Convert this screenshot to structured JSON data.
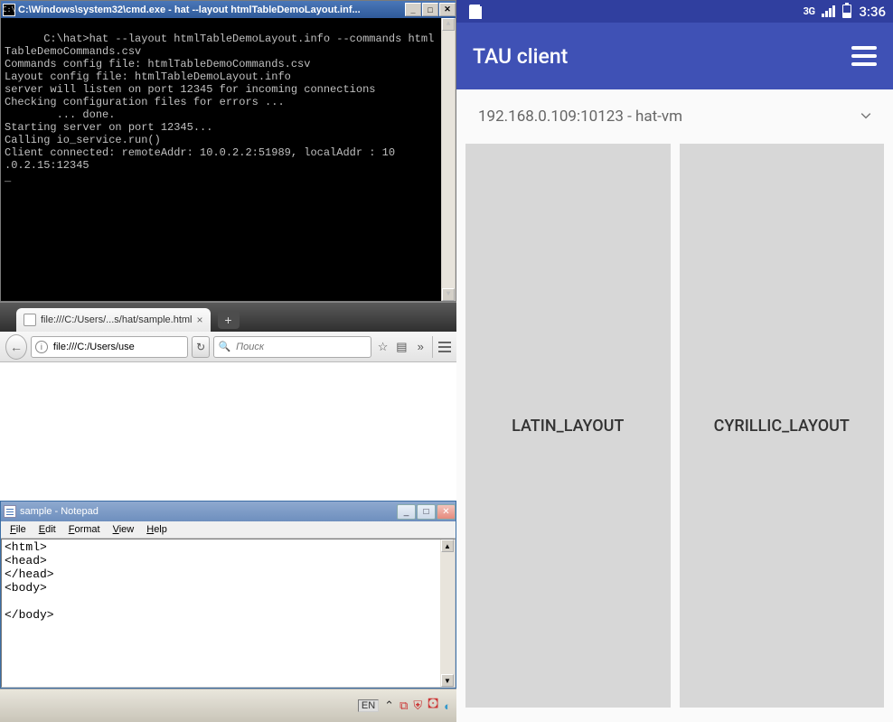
{
  "cmd": {
    "title": "C:\\Windows\\system32\\cmd.exe - hat  --layout htmlTableDemoLayout.inf...",
    "icon_label": "C:\\",
    "output": "C:\\hat>hat --layout htmlTableDemoLayout.info --commands html\nTableDemoCommands.csv\nCommands config file: htmlTableDemoCommands.csv\nLayout config file: htmlTableDemoLayout.info\nserver will listen on port 12345 for incoming connections\nChecking configuration files for errors ...\n        ... done.\nStarting server on port 12345...\nCalling io_service.run()\nClient connected: remoteAddr: 10.0.2.2:51989, localAddr : 10\n.0.2.15:12345\n_"
  },
  "browser": {
    "tab_label": "file:///C:/Users/...s/hat/sample.html",
    "url_value": "file:///C:/Users/use",
    "search_placeholder": "Поиск"
  },
  "notepad": {
    "title": "sample - Notepad",
    "menu": {
      "file": "File",
      "edit": "Edit",
      "format": "Format",
      "view": "View",
      "help": "Help"
    },
    "content": "<html>\n<head>\n</head>\n<body>\n\n</body>"
  },
  "taskbar": {
    "lang": "EN"
  },
  "android": {
    "status": {
      "net": "3G",
      "time": "3:36"
    },
    "app_title": "TAU client",
    "dropdown": "192.168.0.109:10123 - hat-vm",
    "cards": {
      "left": "LATIN_LAYOUT",
      "right": "CYRILLIC_LAYOUT"
    }
  }
}
